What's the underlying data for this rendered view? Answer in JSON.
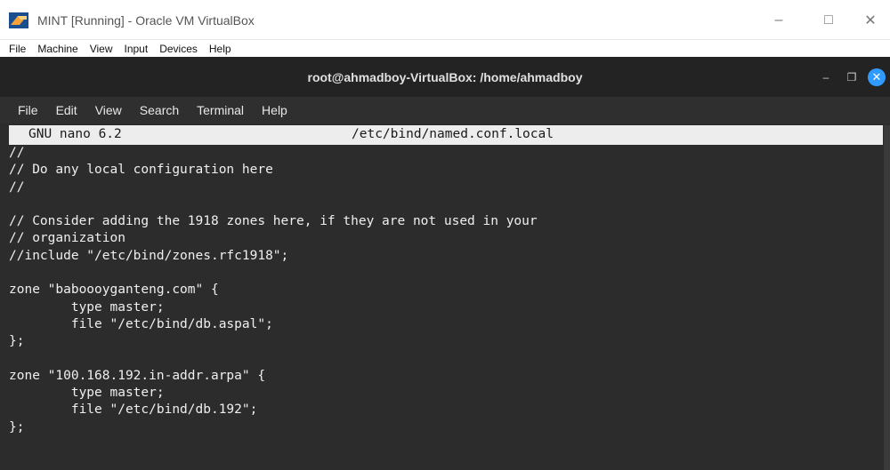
{
  "vbox": {
    "title": "MINT [Running] - Oracle VM VirtualBox",
    "menu": [
      "File",
      "Machine",
      "View",
      "Input",
      "Devices",
      "Help"
    ]
  },
  "terminal": {
    "title": "root@ahmadboy-VirtualBox: /home/ahmadboy",
    "menu": [
      "File",
      "Edit",
      "View",
      "Search",
      "Terminal",
      "Help"
    ]
  },
  "nano": {
    "version": "GNU nano 6.2",
    "filename": "/etc/bind/named.conf.local",
    "lines": [
      "//",
      "// Do any local configuration here",
      "//",
      "",
      "// Consider adding the 1918 zones here, if they are not used in your",
      "// organization",
      "//include \"/etc/bind/zones.rfc1918\";",
      "",
      "zone \"baboooyganteng.com\" {",
      "        type master;",
      "        file \"/etc/bind/db.aspal\";",
      "};",
      "",
      "zone \"100.168.192.in-addr.arpa\" {",
      "        type master;",
      "        file \"/etc/bind/db.192\";",
      "};"
    ]
  },
  "icons": {
    "app": "virtualbox-logo",
    "window_controls": [
      "minimize-icon",
      "maximize-icon",
      "close-icon"
    ],
    "terminal_controls": [
      "minimize-icon",
      "restore-icon",
      "close-icon"
    ]
  },
  "colors": {
    "terminal_bg": "#2c2c2c",
    "terminal_titlebar": "#232323",
    "close_button": "#2f9bff",
    "nano_header_bg": "#ededed"
  }
}
